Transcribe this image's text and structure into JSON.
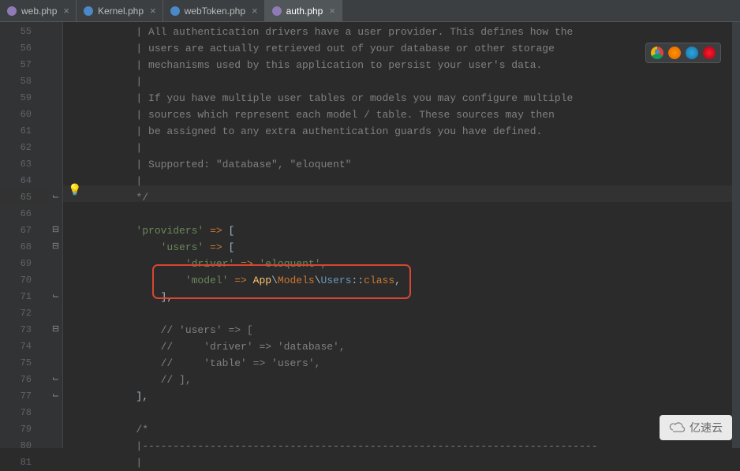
{
  "tabs": [
    {
      "name": "web.php",
      "icon_color": "#8e7ab5",
      "active": false
    },
    {
      "name": "Kernel.php",
      "icon_color": "#4a88c7",
      "active": false
    },
    {
      "name": "webToken.php",
      "icon_color": "#4a88c7",
      "active": false
    },
    {
      "name": "auth.php",
      "icon_color": "#8e7ab5",
      "active": true
    }
  ],
  "line_start": 55,
  "lines": [
    {
      "n": 55,
      "indent": 2,
      "type": "comment",
      "text": "| All authentication drivers have a user provider. This defines how the"
    },
    {
      "n": 56,
      "indent": 2,
      "type": "comment",
      "text": "| users are actually retrieved out of your database or other storage"
    },
    {
      "n": 57,
      "indent": 2,
      "type": "comment",
      "text": "| mechanisms used by this application to persist your user's data."
    },
    {
      "n": 58,
      "indent": 2,
      "type": "comment",
      "text": "|"
    },
    {
      "n": 59,
      "indent": 2,
      "type": "comment",
      "text": "| If you have multiple user tables or models you may configure multiple"
    },
    {
      "n": 60,
      "indent": 2,
      "type": "comment",
      "text": "| sources which represent each model / table. These sources may then"
    },
    {
      "n": 61,
      "indent": 2,
      "type": "comment",
      "text": "| be assigned to any extra authentication guards you have defined."
    },
    {
      "n": 62,
      "indent": 2,
      "type": "comment",
      "text": "|"
    },
    {
      "n": 63,
      "indent": 2,
      "type": "comment",
      "text": "| Supported: \"database\", \"eloquent\""
    },
    {
      "n": 64,
      "indent": 2,
      "type": "comment",
      "text": "|"
    },
    {
      "n": 65,
      "indent": 2,
      "type": "comment",
      "text": "*/",
      "highlight": true
    },
    {
      "n": 66,
      "indent": 0,
      "type": "blank",
      "text": ""
    },
    {
      "n": 67,
      "indent": 2,
      "type": "kv",
      "key": "'providers'",
      "after": " ["
    },
    {
      "n": 68,
      "indent": 3,
      "type": "kv",
      "key": "'users'",
      "after": " ["
    },
    {
      "n": 69,
      "indent": 4,
      "type": "kv",
      "key": "'driver'",
      "after": " 'eloquent',"
    },
    {
      "n": 70,
      "indent": 4,
      "type": "model",
      "key": "'model'",
      "ns1": "App",
      "ns2": "Models",
      "ns3": "Users",
      "kw": "class"
    },
    {
      "n": 71,
      "indent": 3,
      "type": "plain",
      "text": "],"
    },
    {
      "n": 72,
      "indent": 0,
      "type": "blank",
      "text": ""
    },
    {
      "n": 73,
      "indent": 3,
      "type": "comment",
      "text": "// 'users' => ["
    },
    {
      "n": 74,
      "indent": 3,
      "type": "comment",
      "text": "//     'driver' => 'database',"
    },
    {
      "n": 75,
      "indent": 3,
      "type": "comment",
      "text": "//     'table' => 'users',"
    },
    {
      "n": 76,
      "indent": 3,
      "type": "comment",
      "text": "// ],"
    },
    {
      "n": 77,
      "indent": 2,
      "type": "plain",
      "text": "],"
    },
    {
      "n": 78,
      "indent": 0,
      "type": "blank",
      "text": ""
    },
    {
      "n": 79,
      "indent": 2,
      "type": "comment",
      "text": "/*"
    },
    {
      "n": 80,
      "indent": 2,
      "type": "comment",
      "text": "|--------------------------------------------------------------------------"
    },
    {
      "n": 81,
      "indent": 2,
      "type": "comment",
      "text": "| "
    }
  ],
  "fold_marks": {
    "65": "up",
    "67": "down",
    "68": "down",
    "71": "up",
    "73": "down",
    "76": "up",
    "77": "up"
  },
  "browser_icons": [
    "chrome",
    "firefox",
    "safari",
    "opera"
  ],
  "watermark": "亿速云"
}
